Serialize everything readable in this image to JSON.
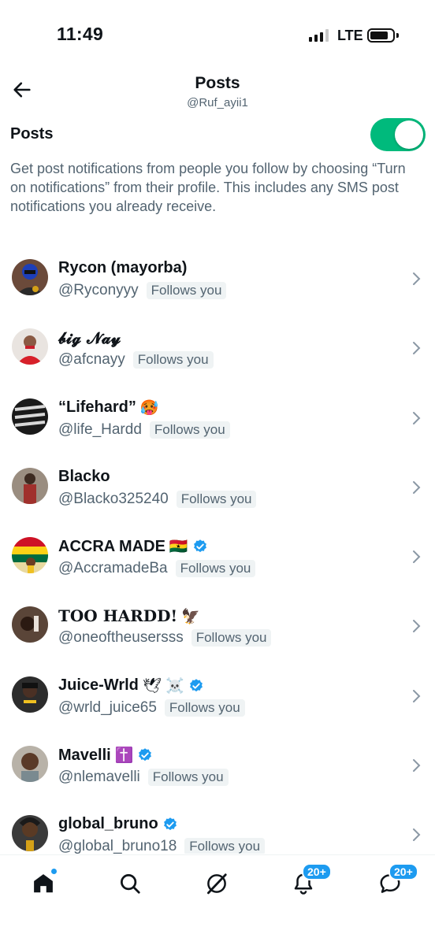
{
  "status_bar": {
    "time": "11:49",
    "network": "LTE"
  },
  "header": {
    "title": "Posts",
    "subtitle": "@Ruf_ayii1",
    "back_icon": "back-arrow-icon"
  },
  "posts_setting": {
    "label": "Posts",
    "toggle_on": true,
    "toggle_color": "#00ba7c",
    "description": "Get post notifications from people you follow by choosing “Turn on notifications” from their profile. This includes any SMS post notifications you already receive."
  },
  "users": [
    {
      "name": "Rycon (mayorba)",
      "handle": "@Ryconyyy",
      "badge": "Follows you",
      "verified": false,
      "emoji": ""
    },
    {
      "name": "𝓫𝓲𝓰 𝓝𝓪𝔂",
      "handle": "@afcnayy",
      "badge": "Follows you",
      "verified": false,
      "emoji": ""
    },
    {
      "name": "“Lifehard”",
      "handle": "@life_Hardd",
      "badge": "Follows you",
      "verified": false,
      "emoji": "🥵"
    },
    {
      "name": "Blacko",
      "handle": "@Blacko325240",
      "badge": "Follows you",
      "verified": false,
      "emoji": ""
    },
    {
      "name": "ACCRA MADE",
      "handle": "@AccramadeBa",
      "badge": "Follows you",
      "verified": true,
      "emoji": "🇬🇭"
    },
    {
      "name": "TOO HARDD!",
      "handle": "@oneoftheusersss",
      "badge": "Follows you",
      "verified": false,
      "emoji": "🦅"
    },
    {
      "name": "Juice-Wrld",
      "handle": "@wrld_juice65",
      "badge": "Follows you",
      "verified": true,
      "emoji": "🕊 ☠️"
    },
    {
      "name": "Mavelli",
      "handle": "@nlemavelli",
      "badge": "Follows you",
      "verified": true,
      "emoji": "✝️"
    },
    {
      "name": "global_bruno",
      "handle": "@global_bruno18",
      "badge": "Follows you",
      "verified": true,
      "emoji": ""
    }
  ],
  "bottom_nav": {
    "items": [
      {
        "name": "home-icon",
        "active": true
      },
      {
        "name": "search-icon"
      },
      {
        "name": "grok-icon"
      },
      {
        "name": "notifications-icon",
        "badge": "20+"
      },
      {
        "name": "messages-icon",
        "badge": "20+"
      }
    ]
  },
  "colors": {
    "accent": "#1d9bf0",
    "toggle": "#00ba7c",
    "secondary_text": "#536471"
  }
}
